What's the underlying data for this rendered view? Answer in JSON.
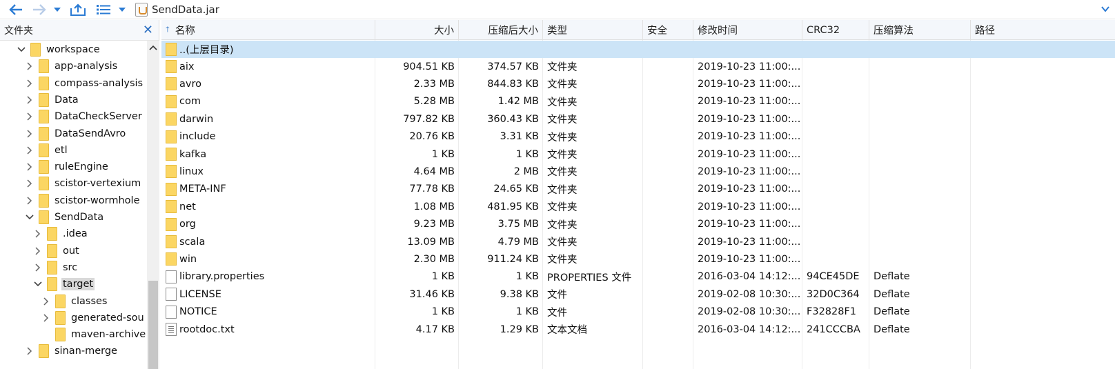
{
  "toolbar": {
    "path": "SendData.jar",
    "back_icon": "back-arrow-icon",
    "forward_icon": "forward-arrow-icon",
    "up_icon": "up-folder-icon",
    "view_icon": "list-view-icon"
  },
  "tree": {
    "title": "文件夹",
    "close": "✕",
    "items": [
      {
        "label": "workspace",
        "level": 0,
        "expanded": true
      },
      {
        "label": "app-analysis",
        "level": 1,
        "expanded": false
      },
      {
        "label": "compass-analysis",
        "level": 1,
        "expanded": false
      },
      {
        "label": "Data",
        "level": 1,
        "expanded": false
      },
      {
        "label": "DataCheckServer",
        "level": 1,
        "expanded": false
      },
      {
        "label": "DataSendAvro",
        "level": 1,
        "expanded": false
      },
      {
        "label": "etl",
        "level": 1,
        "expanded": false
      },
      {
        "label": "ruleEngine",
        "level": 1,
        "expanded": false
      },
      {
        "label": "scistor-vertexium",
        "level": 1,
        "expanded": false
      },
      {
        "label": "scistor-wormhole",
        "level": 1,
        "expanded": false
      },
      {
        "label": "SendData",
        "level": 1,
        "expanded": true
      },
      {
        "label": ".idea",
        "level": 2,
        "expanded": false
      },
      {
        "label": "out",
        "level": 2,
        "expanded": false
      },
      {
        "label": "src",
        "level": 2,
        "expanded": false
      },
      {
        "label": "target",
        "level": 2,
        "expanded": true,
        "selected": true
      },
      {
        "label": "classes",
        "level": 3,
        "expanded": false
      },
      {
        "label": "generated-sou",
        "level": 3,
        "expanded": false
      },
      {
        "label": "maven-archive",
        "level": 3,
        "leaf": true
      },
      {
        "label": "sinan-merge",
        "level": 1,
        "expanded": false
      }
    ]
  },
  "columns": {
    "name": "名称",
    "size": "大小",
    "packed": "压缩后大小",
    "type": "类型",
    "security": "安全",
    "modified": "修改时间",
    "crc": "CRC32",
    "method": "压缩算法",
    "path": "路径"
  },
  "parent_row": "..(上层目录)",
  "files": [
    {
      "name": "aix",
      "size": "904.51 KB",
      "packed": "374.57 KB",
      "type": "文件夹",
      "modified": "2019-10-23 11:00:...",
      "crc": "",
      "method": "",
      "icon": "folder"
    },
    {
      "name": "avro",
      "size": "2.33 MB",
      "packed": "844.83 KB",
      "type": "文件夹",
      "modified": "2019-10-23 11:00:...",
      "crc": "",
      "method": "",
      "icon": "folder"
    },
    {
      "name": "com",
      "size": "5.28 MB",
      "packed": "1.42 MB",
      "type": "文件夹",
      "modified": "2019-10-23 11:00:...",
      "crc": "",
      "method": "",
      "icon": "folder"
    },
    {
      "name": "darwin",
      "size": "797.82 KB",
      "packed": "360.43 KB",
      "type": "文件夹",
      "modified": "2019-10-23 11:00:...",
      "crc": "",
      "method": "",
      "icon": "folder"
    },
    {
      "name": "include",
      "size": "20.76 KB",
      "packed": "3.31 KB",
      "type": "文件夹",
      "modified": "2019-10-23 11:00:...",
      "crc": "",
      "method": "",
      "icon": "folder"
    },
    {
      "name": "kafka",
      "size": "1 KB",
      "packed": "1 KB",
      "type": "文件夹",
      "modified": "2019-10-23 11:00:...",
      "crc": "",
      "method": "",
      "icon": "folder"
    },
    {
      "name": "linux",
      "size": "4.64 MB",
      "packed": "2 MB",
      "type": "文件夹",
      "modified": "2019-10-23 11:00:...",
      "crc": "",
      "method": "",
      "icon": "folder"
    },
    {
      "name": "META-INF",
      "size": "77.78 KB",
      "packed": "24.65 KB",
      "type": "文件夹",
      "modified": "2019-10-23 11:00:...",
      "crc": "",
      "method": "",
      "icon": "folder"
    },
    {
      "name": "net",
      "size": "1.08 MB",
      "packed": "481.95 KB",
      "type": "文件夹",
      "modified": "2019-10-23 11:00:...",
      "crc": "",
      "method": "",
      "icon": "folder"
    },
    {
      "name": "org",
      "size": "9.23 MB",
      "packed": "3.75 MB",
      "type": "文件夹",
      "modified": "2019-10-23 11:00:...",
      "crc": "",
      "method": "",
      "icon": "folder"
    },
    {
      "name": "scala",
      "size": "13.09 MB",
      "packed": "4.79 MB",
      "type": "文件夹",
      "modified": "2019-10-23 11:00:...",
      "crc": "",
      "method": "",
      "icon": "folder"
    },
    {
      "name": "win",
      "size": "2.30 MB",
      "packed": "911.24 KB",
      "type": "文件夹",
      "modified": "2019-10-23 11:00:...",
      "crc": "",
      "method": "",
      "icon": "folder"
    },
    {
      "name": "library.properties",
      "size": "1 KB",
      "packed": "1 KB",
      "type": "PROPERTIES 文件",
      "modified": "2016-03-04 14:12:...",
      "crc": "94CE45DE",
      "method": "Deflate",
      "icon": "file"
    },
    {
      "name": "LICENSE",
      "size": "31.46 KB",
      "packed": "9.38 KB",
      "type": "文件",
      "modified": "2019-02-08 10:30:...",
      "crc": "32D0C364",
      "method": "Deflate",
      "icon": "file"
    },
    {
      "name": "NOTICE",
      "size": "1 KB",
      "packed": "1 KB",
      "type": "文件",
      "modified": "2019-02-08 10:30:...",
      "crc": "F32828F1",
      "method": "Deflate",
      "icon": "file"
    },
    {
      "name": "rootdoc.txt",
      "size": "4.17 KB",
      "packed": "1.29 KB",
      "type": "文本文档",
      "modified": "2016-03-04 14:12:...",
      "crc": "241CCCBA",
      "method": "Deflate",
      "icon": "text"
    }
  ]
}
